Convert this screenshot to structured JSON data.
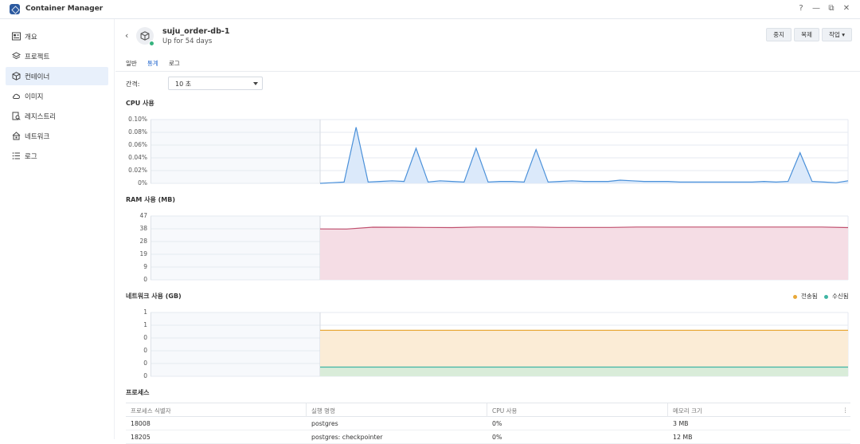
{
  "app": {
    "title": "Container Manager"
  },
  "window_controls": [
    "?",
    "—",
    "⧉",
    "✕"
  ],
  "sidebar": {
    "items": [
      {
        "label": "개요",
        "icon": "overview-icon",
        "active": false
      },
      {
        "label": "프로젝트",
        "icon": "project-layers-icon",
        "active": false
      },
      {
        "label": "컨테이너",
        "icon": "container-box-icon",
        "active": true
      },
      {
        "label": "이미지",
        "icon": "cloud-icon",
        "active": false
      },
      {
        "label": "레지스트리",
        "icon": "registry-search-icon",
        "active": false
      },
      {
        "label": "네트워크",
        "icon": "network-house-icon",
        "active": false
      },
      {
        "label": "로그",
        "icon": "list-icon",
        "active": false
      }
    ]
  },
  "container": {
    "name": "suju_order-db-1",
    "status": "Up for 54 days",
    "status_color": "#36b37e"
  },
  "actions": {
    "stop": "중지",
    "duplicate": "복제",
    "action": "작업"
  },
  "tabs": [
    {
      "label": "일반",
      "active": false
    },
    {
      "label": "통계",
      "active": true
    },
    {
      "label": "로그",
      "active": false
    }
  ],
  "interval": {
    "label": "간격:",
    "value": "10 초"
  },
  "cpu_chart": {
    "title": "CPU 사용",
    "yticks": [
      "0.10%",
      "0.08%",
      "0.06%",
      "0.04%",
      "0.02%",
      "0%"
    ],
    "color": "#4a90d9",
    "fill": "#dbe9fa"
  },
  "ram_chart": {
    "title": "RAM 사용 (MB)",
    "yticks": [
      "47",
      "38",
      "28",
      "19",
      "9",
      "0"
    ],
    "color": "#c0506e",
    "fill": "#f5dde5"
  },
  "net_chart": {
    "title": "네트워크 사용 (GB)",
    "yticks": [
      "1",
      "1",
      "0",
      "0",
      "0",
      "0"
    ],
    "legend": [
      {
        "label": "전송됨",
        "color": "#e8a838"
      },
      {
        "label": "수신됨",
        "color": "#3fb5a3"
      }
    ]
  },
  "chart_data": [
    {
      "type": "area",
      "title": "CPU 사용",
      "ylabel": "",
      "ylim": [
        0,
        0.1
      ],
      "x": [
        0,
        1,
        2,
        3,
        4,
        5,
        6,
        7,
        8,
        9,
        10,
        11,
        12,
        13,
        14,
        15,
        16,
        17,
        18,
        19,
        20,
        21,
        22,
        23,
        24,
        25,
        26,
        27,
        28,
        29,
        30,
        31,
        32,
        33,
        34,
        35,
        36,
        37,
        38,
        39,
        40,
        41,
        42,
        43,
        44
      ],
      "series": [
        {
          "values": [
            0.0,
            0.001,
            0.002,
            0.088,
            0.002,
            0.003,
            0.004,
            0.003,
            0.055,
            0.002,
            0.004,
            0.003,
            0.002,
            0.055,
            0.002,
            0.003,
            0.003,
            0.002,
            0.053,
            0.002,
            0.003,
            0.004,
            0.003,
            0.003,
            0.003,
            0.005,
            0.004,
            0.003,
            0.003,
            0.003,
            0.002,
            0.002,
            0.002,
            0.002,
            0.002,
            0.002,
            0.002,
            0.003,
            0.002,
            0.003,
            0.048,
            0.003,
            0.002,
            0.001,
            0.004
          ]
        }
      ]
    },
    {
      "type": "area",
      "title": "RAM 사용 (MB)",
      "ylabel": "",
      "ylim": [
        0,
        47
      ],
      "x": [
        0,
        1,
        2,
        3,
        4,
        5,
        6,
        7,
        8,
        9,
        10,
        11,
        12,
        13,
        14,
        15,
        16,
        17,
        18,
        19,
        20
      ],
      "series": [
        {
          "values": [
            37.5,
            37.4,
            38.8,
            38.7,
            38.6,
            38.5,
            38.9,
            38.9,
            38.9,
            38.6,
            38.6,
            38.6,
            38.9,
            38.9,
            38.9,
            38.9,
            38.9,
            38.9,
            38.9,
            38.9,
            38.5
          ]
        }
      ]
    },
    {
      "type": "area",
      "title": "네트워크 사용 (GB)",
      "ylabel": "",
      "ylim": [
        0,
        1.25
      ],
      "x": [
        0,
        1
      ],
      "series": [
        {
          "name": "전송됨",
          "values": [
            0.9,
            0.9
          ]
        },
        {
          "name": "수신됨",
          "values": [
            0.18,
            0.18
          ]
        }
      ]
    }
  ],
  "process": {
    "title": "프로세스",
    "columns": [
      "프로세스 식별자",
      "실행 명령",
      "CPU 사용",
      "메모리 크기"
    ],
    "rows": [
      [
        "18008",
        "postgres",
        "0%",
        "3 MB"
      ],
      [
        "18205",
        "postgres: checkpointer",
        "0%",
        "12 MB"
      ]
    ]
  }
}
